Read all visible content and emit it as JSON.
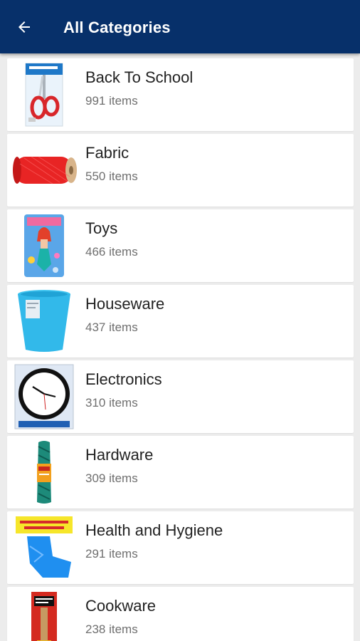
{
  "appbar": {
    "title": "All Categories",
    "back_icon": "arrow-left-icon"
  },
  "categories": [
    {
      "name": "Back To School",
      "count": "991 items",
      "image": "scissors-package-image"
    },
    {
      "name": "Fabric",
      "count": "550 items",
      "image": "red-thread-spool-image"
    },
    {
      "name": "Toys",
      "count": "466 items",
      "image": "mermaid-doll-package-image"
    },
    {
      "name": "Houseware",
      "count": "437 items",
      "image": "blue-wastebasket-image"
    },
    {
      "name": "Electronics",
      "count": "310 items",
      "image": "wall-clock-image"
    },
    {
      "name": "Hardware",
      "count": "309 items",
      "image": "green-rope-image"
    },
    {
      "name": "Health and Hygiene",
      "count": "291 items",
      "image": "ankle-support-image"
    },
    {
      "name": "Cookware",
      "count": "238 items",
      "image": "cooking-utensil-package-image"
    }
  ],
  "colors": {
    "appbar": "#07306a",
    "background": "#ececec",
    "card": "#ffffff",
    "title_text": "#222222",
    "count_text": "#6f6f6f"
  }
}
